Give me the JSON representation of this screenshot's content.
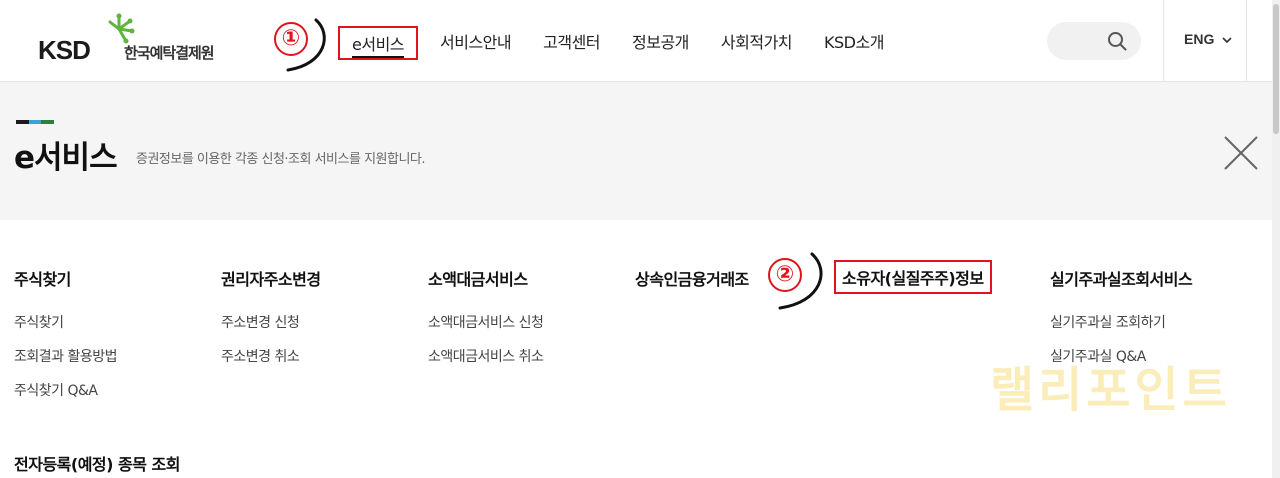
{
  "logo": {
    "abbr": "KSD",
    "name": "한국예탁결제원"
  },
  "nav": {
    "items": [
      "e서비스",
      "서비스안내",
      "고객센터",
      "정보공개",
      "사회적가치",
      "KSD소개"
    ],
    "active_index": 0
  },
  "markers": {
    "one": "①",
    "two": "②"
  },
  "search": {
    "icon": "search-icon"
  },
  "lang": "ENG",
  "banner": {
    "title": "e서비스",
    "description": "증권정보를 이용한 각종 신청·조회 서비스를 지원합니다.",
    "deco_colors": [
      "#1a1a1a",
      "#3aa3d8",
      "#2d7f3a"
    ]
  },
  "menu": {
    "columns": [
      {
        "title": "주식찾기",
        "items": [
          "주식찾기",
          "조회결과 활용방법",
          "주식찾기 Q&A"
        ]
      },
      {
        "title": "권리자주소변경",
        "items": [
          "주소변경 신청",
          "주소변경 취소"
        ]
      },
      {
        "title": "소액대금서비스",
        "items": [
          "소액대금서비스 신청",
          "소액대금서비스 취소"
        ]
      },
      {
        "title": "상속인금융거래조",
        "items": []
      },
      {
        "title": "소유자(실질주주)정보",
        "items": []
      },
      {
        "title": "실기주과실조회서비스",
        "items": [
          "실기주과실 조회하기",
          "실기주과실 Q&A"
        ]
      }
    ],
    "bottom_title": "전자등록(예정) 종목 조회"
  },
  "watermark": "랠리포인트",
  "colors": {
    "highlight": "#e0141e",
    "logo_green": "#5fb43c"
  }
}
